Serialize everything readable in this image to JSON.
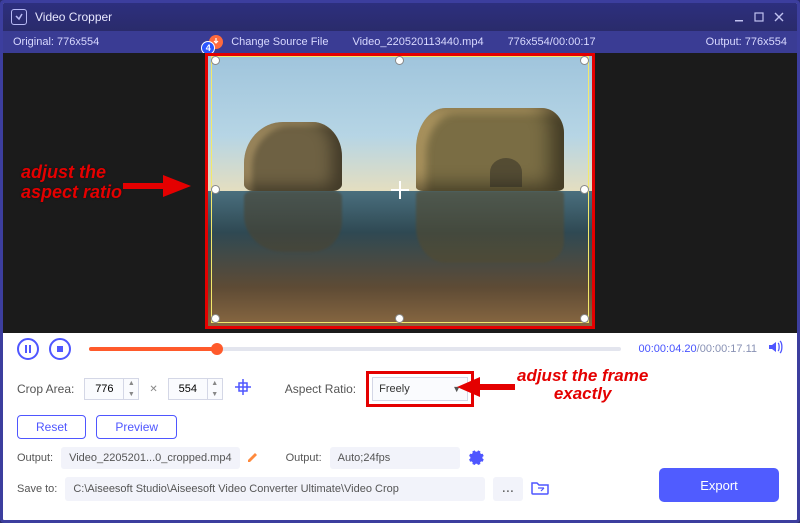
{
  "titlebar": {
    "title": "Video Cropper",
    "badge": "4"
  },
  "info": {
    "original": "Original: 776x554",
    "change_source": "Change Source File",
    "filename": "Video_220520113440.mp4",
    "dims_dur": "776x554/00:00:17",
    "output": "Output: 776x554"
  },
  "annotations": {
    "aspect": "adjust the\naspect ratio",
    "frame": "adjust the frame\nexactly"
  },
  "player": {
    "current": "00:00:04.20",
    "sep": "/",
    "total": "00:00:17.11"
  },
  "crop": {
    "area_label": "Crop Area:",
    "width": "776",
    "height": "554",
    "aspect_label": "Aspect Ratio:",
    "aspect_value": "Freely",
    "reset": "Reset",
    "preview": "Preview"
  },
  "output": {
    "label1": "Output:",
    "filename": "Video_2205201...0_cropped.mp4",
    "label2": "Output:",
    "setting": "Auto;24fps"
  },
  "save": {
    "label": "Save to:",
    "path": "C:\\Aiseesoft Studio\\Aiseesoft Video Converter Ultimate\\Video Crop"
  },
  "export": "Export"
}
